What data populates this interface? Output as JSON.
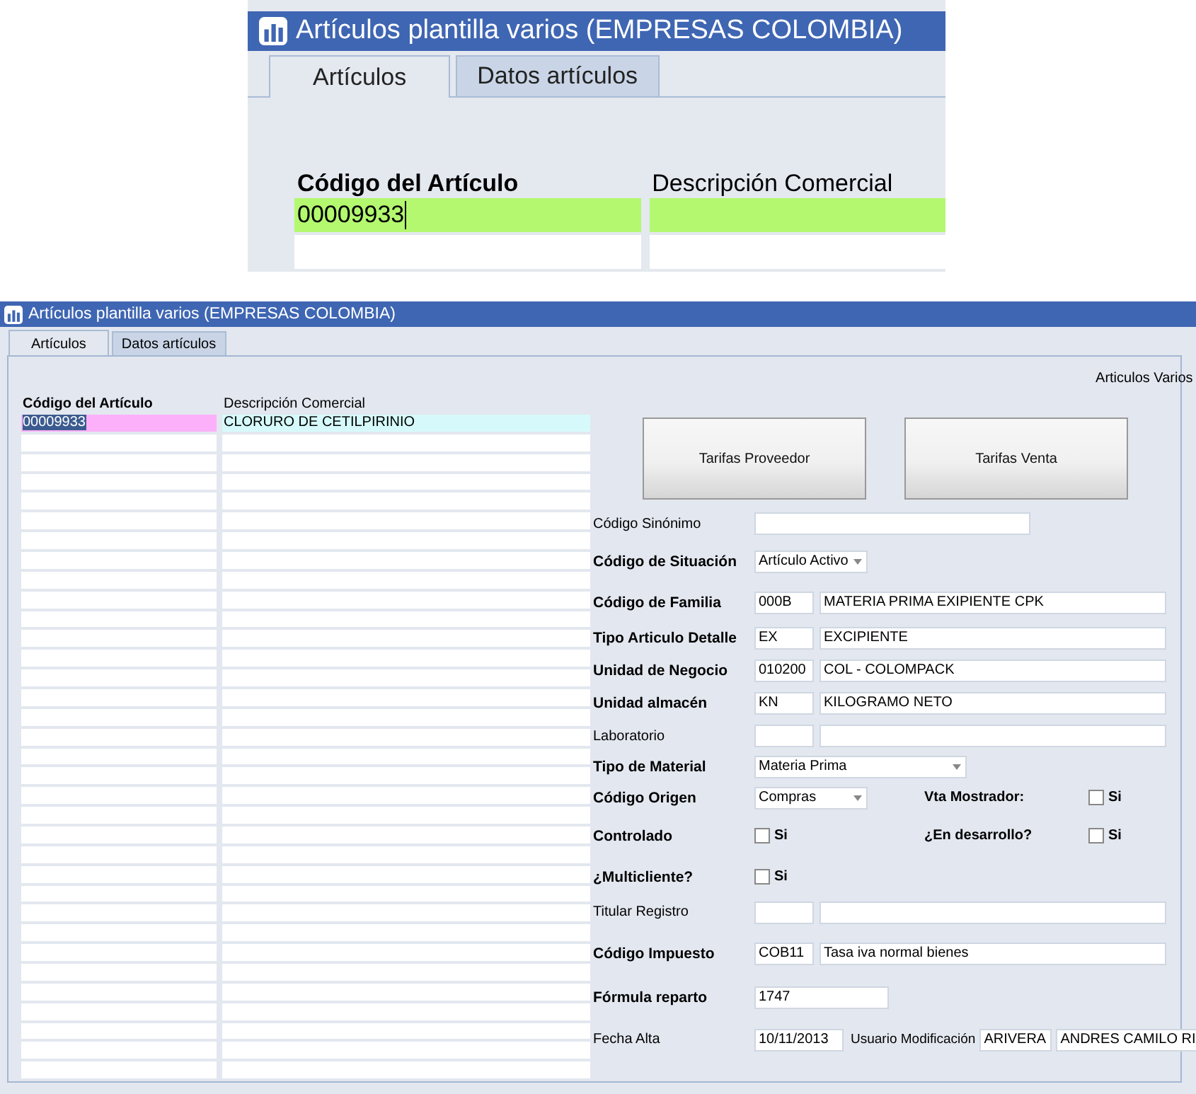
{
  "inset": {
    "title": "Artículos plantilla varios (EMPRESAS COLOMBIA)",
    "tabs": [
      {
        "label": "Artículos",
        "selected": true
      },
      {
        "label": "Datos artículos",
        "selected": false
      }
    ],
    "columns": [
      "Código del Artículo",
      "Descripción Comercial"
    ],
    "rows": [
      {
        "cells": [
          "00009933"
        ],
        "selected": true
      }
    ]
  },
  "window": {
    "title": "Artículos plantilla varios (EMPRESAS COLOMBIA)"
  },
  "tabs": [
    {
      "label": "Artículos",
      "selected": true
    },
    {
      "label": "Datos artículos",
      "selected": false
    }
  ],
  "grid": {
    "columns": [
      "Código del Artículo",
      "Descripción Comercial"
    ],
    "rows": [
      {
        "cells": [
          "00009933",
          "CLORURO DE CETILPIRINIO"
        ],
        "selected": true
      }
    ]
  },
  "section_label": "Articulos Varios",
  "buttons": [
    "Tarifas Proveedor",
    "Tarifas Venta"
  ],
  "form": [
    {
      "label": "Código Sinónimo",
      "bold": false,
      "fields": [
        {
          "kind": "text"
        }
      ]
    },
    {
      "label": "Código de Situación",
      "bold": true,
      "fields": [
        {
          "kind": "select",
          "value": "Artículo Activo"
        }
      ]
    },
    {
      "label": "Código de Familia",
      "bold": true,
      "fields": [
        {
          "kind": "code",
          "value": "000B"
        },
        {
          "kind": "desc",
          "value": "MATERIA PRIMA EXIPIENTE CPK"
        }
      ]
    },
    {
      "label": "Tipo Articulo Detalle",
      "bold": true,
      "fields": [
        {
          "kind": "code",
          "value": "EX"
        },
        {
          "kind": "desc",
          "value": "EXCIPIENTE"
        }
      ]
    },
    {
      "label": "Unidad de Negocio",
      "bold": true,
      "fields": [
        {
          "kind": "code",
          "value": "010200"
        },
        {
          "kind": "desc",
          "value": "COL - COLOMPACK"
        }
      ]
    },
    {
      "label": "Unidad almacén",
      "bold": true,
      "fields": [
        {
          "kind": "code",
          "value": "KN"
        },
        {
          "kind": "desc",
          "value": "KILOGRAMO NETO"
        }
      ]
    },
    {
      "label": "Laboratorio",
      "bold": false,
      "fields": [
        {
          "kind": "code"
        },
        {
          "kind": "desc"
        }
      ]
    },
    {
      "label": "Tipo de Material",
      "bold": true,
      "fields": [
        {
          "kind": "select-wide",
          "value": "Materia Prima"
        }
      ]
    },
    {
      "label": "Código Origen",
      "bold": true,
      "fields": [
        {
          "kind": "select",
          "value": "Compras"
        }
      ],
      "side": {
        "label": "Vta Mostrador:",
        "fields": [
          {
            "kind": "checkbox",
            "option": "Si",
            "checked": false
          }
        ]
      }
    },
    {
      "label": "Controlado",
      "bold": true,
      "fields": [
        {
          "kind": "checkbox",
          "option": "Si",
          "checked": false
        }
      ],
      "side": {
        "label": "¿En desarrollo?",
        "fields": [
          {
            "kind": "checkbox",
            "option": "Si",
            "checked": false
          }
        ]
      }
    },
    {
      "label": "¿Multicliente?",
      "bold": true,
      "fields": [
        {
          "kind": "checkbox",
          "option": "Si",
          "checked": false
        }
      ]
    },
    {
      "label": "Titular Registro",
      "bold": false,
      "fields": [
        {
          "kind": "code"
        },
        {
          "kind": "desc"
        }
      ]
    },
    {
      "label": "Código Impuesto",
      "bold": true,
      "fields": [
        {
          "kind": "code",
          "value": "COB11"
        },
        {
          "kind": "desc",
          "value": "Tasa iva normal bienes"
        }
      ]
    },
    {
      "label": "Fórmula reparto",
      "bold": true,
      "fields": [
        {
          "kind": "number",
          "value": "1747"
        }
      ]
    },
    {
      "label": "Fecha Alta",
      "bold": false,
      "fields": [
        {
          "kind": "date",
          "value": "10/11/2013"
        }
      ],
      "extra": {
        "label": "Usuario Modificación",
        "fields": [
          {
            "kind": "user",
            "value": "ARIVERA"
          },
          {
            "kind": "name",
            "value": "ANDRES CAMILO RI"
          }
        ]
      }
    }
  ]
}
